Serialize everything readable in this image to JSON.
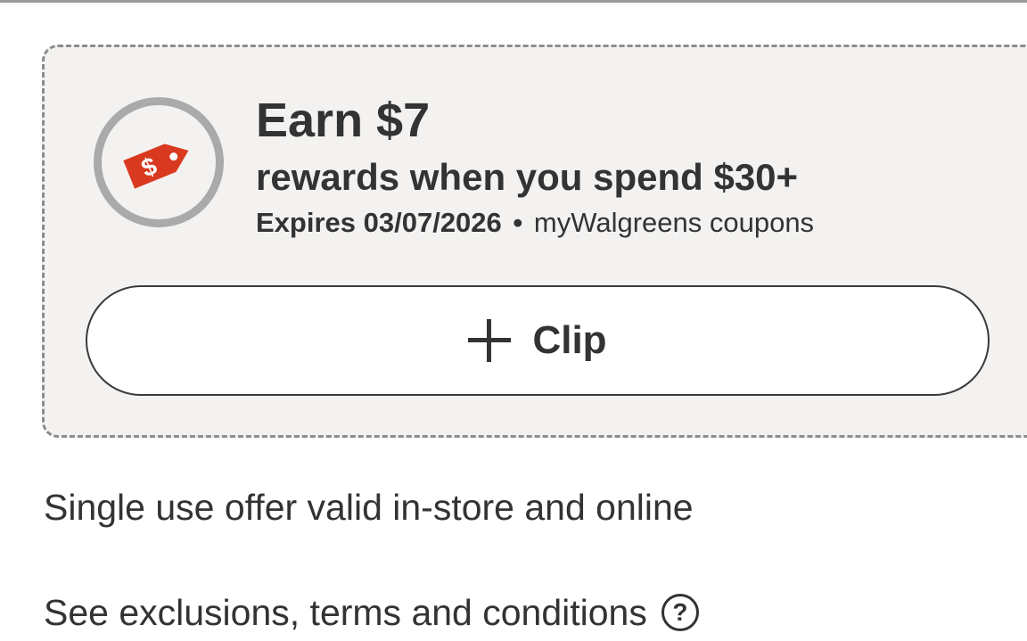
{
  "offer": {
    "title": "Earn $7",
    "subtitle": "rewards when you spend $30+",
    "expires": "Expires 03/07/2026",
    "separator": "•",
    "source": "myWalgreens coupons",
    "icon": "price-tag-icon",
    "tag_symbol": "$",
    "colors": {
      "tag": "#d9391f",
      "badge_ring": "#a9aaaa",
      "card_bg": "#f3f2f0",
      "text": "#333333"
    }
  },
  "clip_button": {
    "icon": "plus-icon",
    "label": "Clip"
  },
  "details": {
    "single_use": "Single use offer valid in-store and online",
    "terms_link": "See exclusions, terms and conditions",
    "help_symbol": "?"
  }
}
